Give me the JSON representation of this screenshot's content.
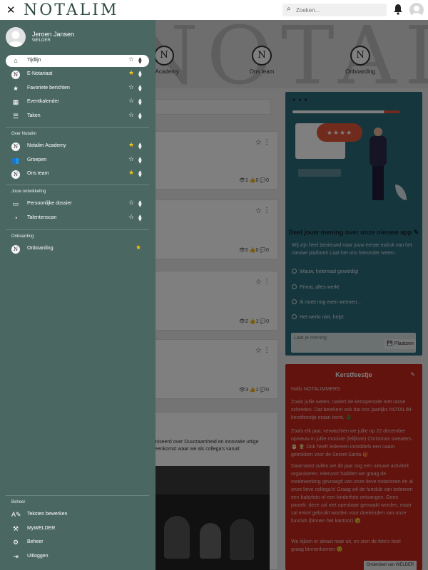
{
  "topbar": {
    "close_icon": "close-icon",
    "logo_text": "NOTALIM",
    "search_placeholder": "Zoeken...",
    "brand_color": "#2f4b44"
  },
  "drawer": {
    "bg_color": "#4b6761",
    "user": {
      "name": "Jeroen Jansen",
      "role": "WELDER"
    },
    "main_items": [
      {
        "label": "Tijdlijn",
        "icon": "home-icon",
        "active": true,
        "favorite": false
      },
      {
        "label": "E-Notariaat",
        "icon": "notalim-logo-icon",
        "active": false,
        "favorite": true
      },
      {
        "label": "Favoriete berichten",
        "icon": "star-icon",
        "active": false,
        "favorite": false
      },
      {
        "label": "Eventkalender",
        "icon": "calendar-icon",
        "active": false,
        "favorite": false
      },
      {
        "label": "Taken",
        "icon": "tasks-icon",
        "active": false,
        "favorite": false
      }
    ],
    "section_over": {
      "title": "Over Notalim",
      "items": [
        {
          "label": "Notalim Academy",
          "icon": "notalim-logo-icon",
          "favorite": true
        },
        {
          "label": "Groepen",
          "icon": "users-icon",
          "favorite": false
        },
        {
          "label": "Ons team",
          "icon": "notalim-logo-icon",
          "favorite": true
        }
      ]
    },
    "section_jouw": {
      "title": "Jouw ontwikkeling",
      "items": [
        {
          "label": "Persoonlijke dossier",
          "icon": "id-card-icon",
          "favorite": false
        },
        {
          "label": "Talentenscan",
          "icon": "pie-chart-icon",
          "favorite": false
        }
      ]
    },
    "section_onboarding": {
      "title": "Onboarding",
      "items": [
        {
          "label": "Onboarding",
          "icon": "notalim-logo-icon",
          "favorite": true
        }
      ]
    },
    "section_beheer": {
      "title": "Beheer",
      "items": [
        {
          "label": "Teksten bewerken",
          "icon": "text-edit-icon"
        },
        {
          "label": "MyWELDER",
          "icon": "welder-icon"
        },
        {
          "label": "Beheer",
          "icon": "gear-icon"
        },
        {
          "label": "Uitloggen",
          "icon": "logout-icon"
        }
      ]
    }
  },
  "background": {
    "hero_text": "NOTALIM",
    "hero_cards": [
      {
        "label": "m Academy"
      },
      {
        "label": "Ons team"
      },
      {
        "label": "Onboarding"
      }
    ],
    "post_stats": [
      {
        "views": "1",
        "likes": "0",
        "comments": "0"
      },
      {
        "views": "5",
        "likes": "0",
        "comments": "0"
      },
      {
        "views": "2",
        "likes": "1",
        "comments": "0"
      },
      {
        "views": "3",
        "likes": "1",
        "comments": "0"
      }
    ],
    "post_text": "ganiseerd over Duurzaamheid en innovatie uttige bijeenkomst waar we als collega's vanuit",
    "poll": {
      "title": "Deel jouw mening over onze nieuwe app",
      "intro": "Wij zijn heel benieuwd naar jouw eerste indruk van het nieuwe platform! Laat het ons hieronder weten.",
      "options": [
        "Wauw, helemaal geweldig!",
        "Prima, alles werkt",
        "Ik moet nog even wennen...",
        "Het werkt niet, help!"
      ],
      "comment_placeholder": "Laat je mening",
      "submit_label": "Plaatsen",
      "color": "#2d6c7d"
    },
    "xmas": {
      "title": "Kerstfeestje",
      "color": "#c4261c",
      "paragraphs": [
        "Hallo NOTALIMMERS",
        "Zoals jullie weten, nadert de kerstperiode met rasse schreden. Dat betekent ook dat ons jaarlijks NOTALIM-kerstfeestje eraan komt. 🎄",
        "Zoals elk jaar, verwachten we jullie op 22 december opnieuw in jullie mooiste (lelijkste) Christmas sweaters. 🎅 🤶 Ook heeft iedereen inmiddels een naam getrokken voor de Secret Santa 🎁",
        "Daarnaast zullen we dit jaar nog een nieuwe activiteit organiseren. Hiervoor hadden we graag de medewerking gevraagd van onze lieve notarissen én al onze lieve collega's! Graag wil de funclub van iedereen een babyfoto of een kinderfoto ontvangen. Geen paniek: deze zal niet openbaar gemaakt worden, maar zal enkel gebruikt worden voor doeleinden van onze funclub (binnen het kantoor) 😉",
        "We kijken er alvast naar uit, en zien de foto's heel graag binnenkomen 😊"
      ],
      "footer": "Onderdeel van WELDER"
    }
  }
}
